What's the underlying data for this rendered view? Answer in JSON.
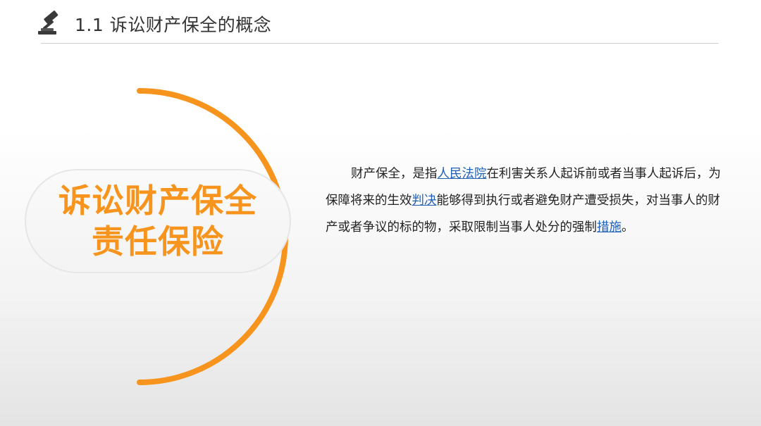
{
  "header": {
    "title": "1.1 诉讼财产保全的概念",
    "icon": "gavel-icon"
  },
  "badge": {
    "line1": "诉讼财产保全",
    "line2": "责任保险",
    "color": "#f7941d"
  },
  "paragraph": {
    "segments": [
      {
        "text": "财产保全，是指",
        "link": false
      },
      {
        "text": "人民法院",
        "link": true
      },
      {
        "text": "在利害关系人起诉前或者当事人起诉后，为保障将来的生效",
        "link": false
      },
      {
        "text": "判决",
        "link": true
      },
      {
        "text": "能够得到执行或者避免财产遭受损失，对当事人的财产或者争议的标的物，采取限制当事人处分的强制",
        "link": false
      },
      {
        "text": "措施",
        "link": true
      },
      {
        "text": "。",
        "link": false
      }
    ]
  },
  "colors": {
    "accent": "#f7941d",
    "link": "#1f5fb8",
    "title": "#333333"
  }
}
